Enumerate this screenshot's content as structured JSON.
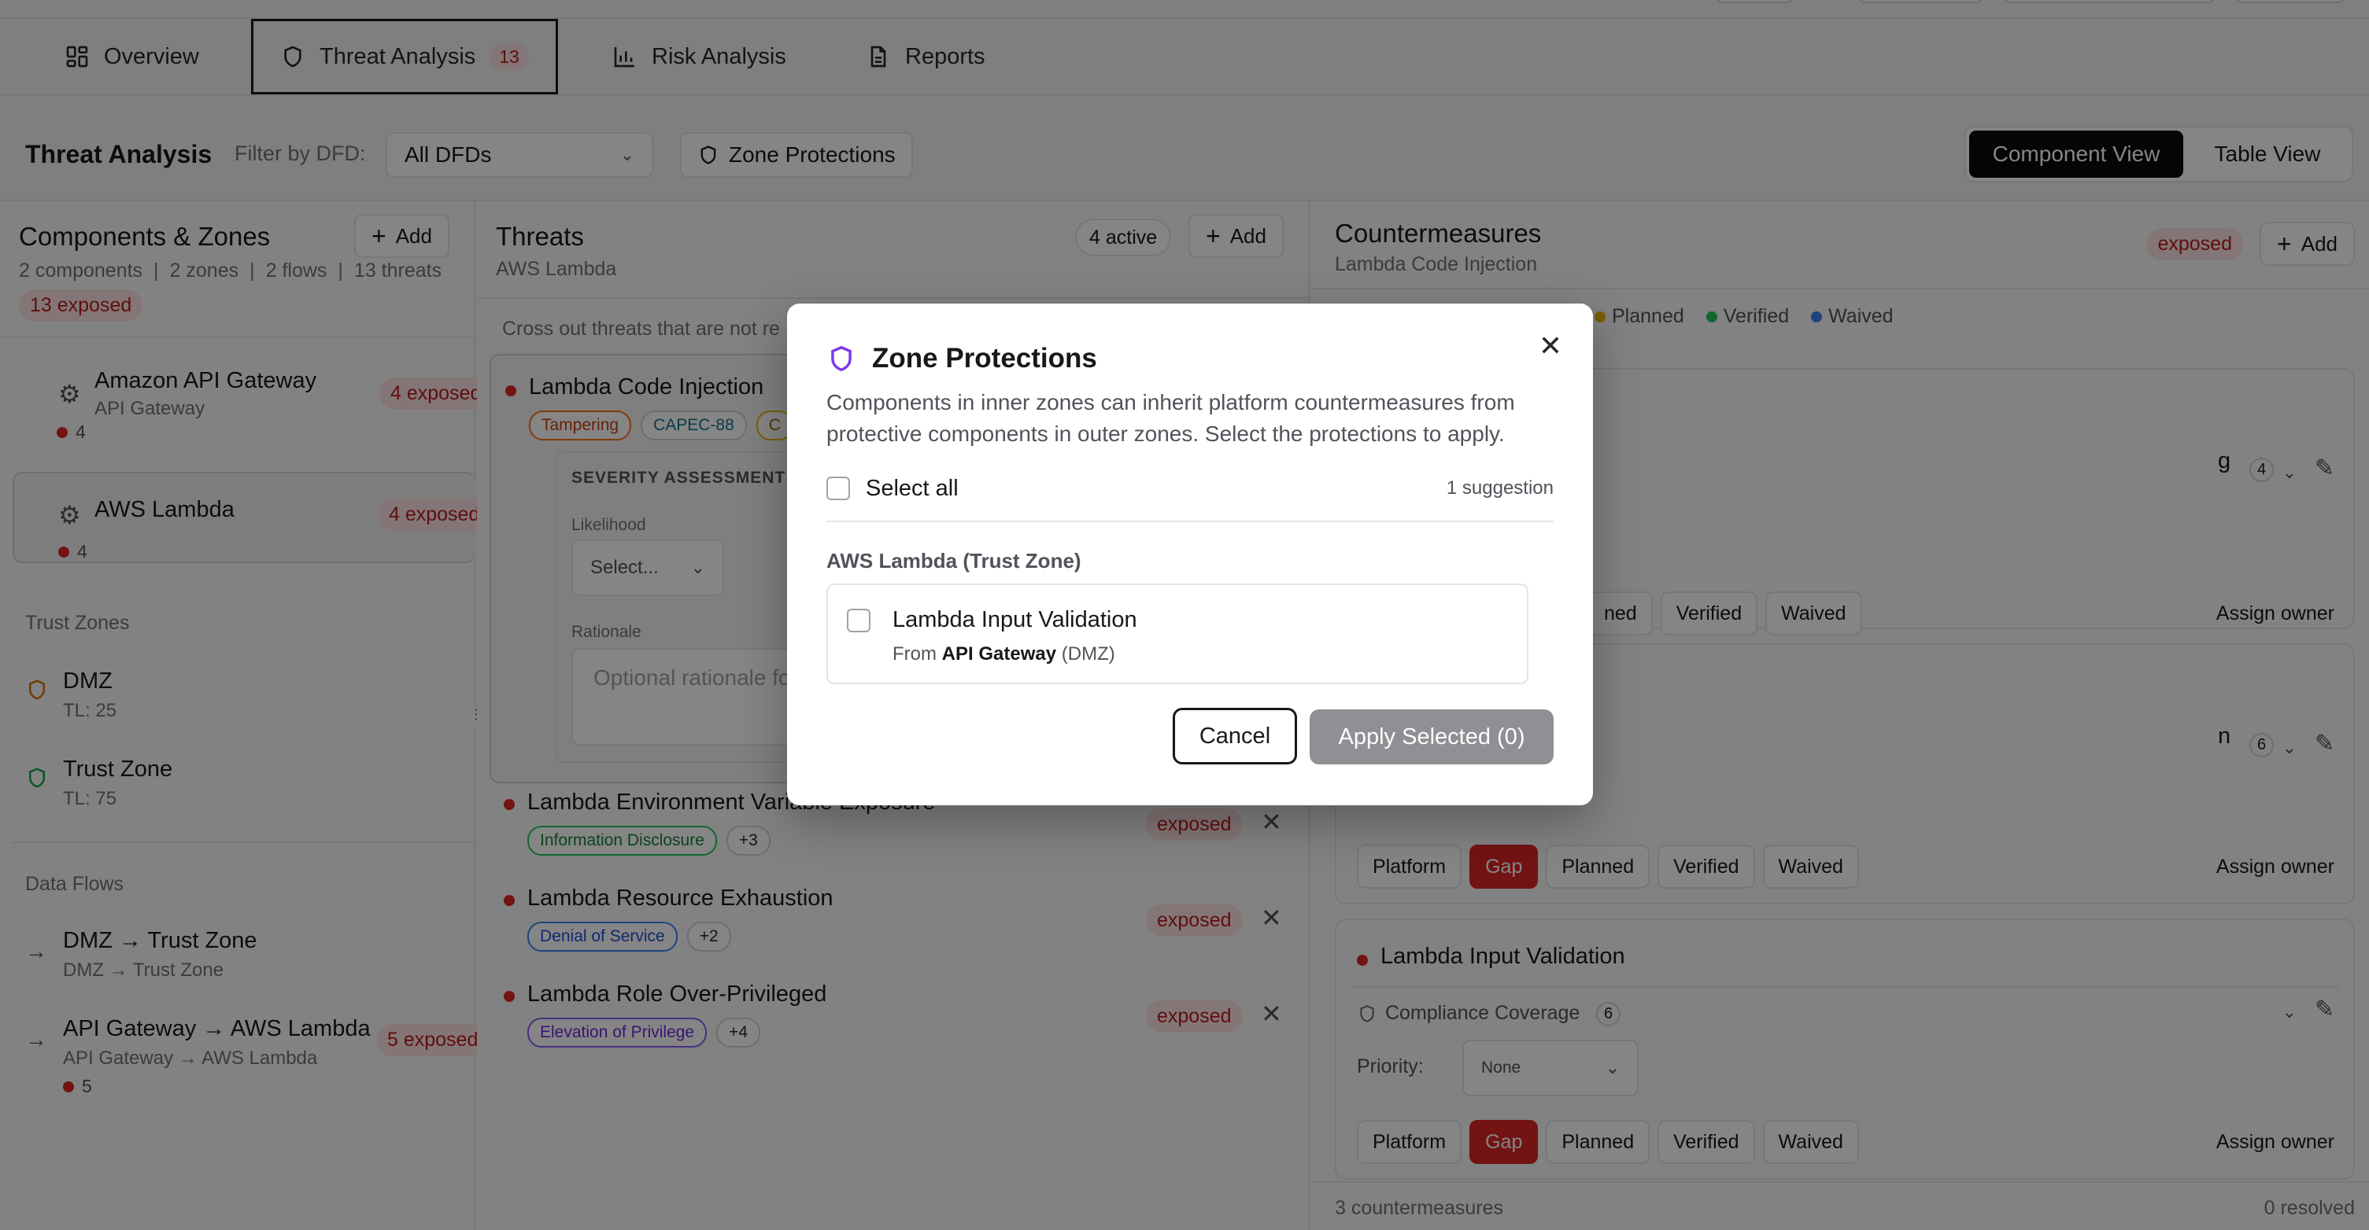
{
  "tabs": [
    {
      "label": "Overview"
    },
    {
      "label": "Threat Analysis",
      "count": "13"
    },
    {
      "label": "Risk Analysis"
    },
    {
      "label": "Reports"
    }
  ],
  "toolbar": {
    "title": "Threat Analysis",
    "filter_label": "Filter by DFD:",
    "filter_value": "All DFDs",
    "zone_protections": "Zone Protections",
    "view_component": "Component View",
    "view_table": "Table View"
  },
  "left": {
    "title": "Components & Zones",
    "add": "Add",
    "stats": {
      "components": "2 components",
      "zones": "2 zones",
      "flows": "2 flows",
      "threats": "13 threats",
      "sep": "|"
    },
    "exposed_badge": "13 exposed",
    "components": [
      {
        "name": "Amazon API Gateway",
        "type": "API Gateway",
        "count": "4",
        "badge": "4 exposed"
      },
      {
        "name": "AWS Lambda",
        "type": "",
        "count": "4",
        "badge": "4 exposed"
      }
    ],
    "zones_title": "Trust Zones",
    "zones": [
      {
        "name": "DMZ",
        "tl": "TL: 25"
      },
      {
        "name": "Trust Zone",
        "tl": "TL: 75"
      }
    ],
    "flows_title": "Data Flows",
    "flows": [
      {
        "name": "DMZ → Trust Zone",
        "sub": "DMZ → Trust Zone"
      },
      {
        "name": "API Gateway → AWS Lambda",
        "sub": "API Gateway → AWS Lambda",
        "count": "5",
        "badge": "5 exposed"
      }
    ]
  },
  "mid": {
    "title": "Threats",
    "subtitle": "AWS Lambda",
    "active": "4 active",
    "add": "Add",
    "hint": "Cross out threats that are not re",
    "first": {
      "name": "Lambda Code Injection",
      "tags": [
        "Tampering",
        "CAPEC-88",
        "C"
      ],
      "severity_title": "SEVERITY ASSESSMENT",
      "likelihood_label": "Likelihood",
      "likelihood_value": "Select...",
      "rationale_label": "Rationale",
      "rationale_placeholder": "Optional rationale fo"
    },
    "threats": [
      {
        "name": "Lambda Environment Variable Exposure",
        "tag": "Information Disclosure",
        "more": "+3",
        "status": "exposed"
      },
      {
        "name": "Lambda Resource Exhaustion",
        "tag": "Denial of Service",
        "more": "+2",
        "status": "exposed"
      },
      {
        "name": "Lambda Role Over-Privileged",
        "tag": "Elevation of Privilege",
        "more": "+4",
        "status": "exposed"
      }
    ]
  },
  "right": {
    "title": "Countermeasures",
    "subtitle": "Lambda Code Injection",
    "exposed": "exposed",
    "add": "Add",
    "legend": [
      "Planned",
      "Verified",
      "Waived"
    ],
    "cards": [
      {
        "name_tail": "g",
        "coverage_count": "4",
        "statuses": [
          "ned",
          "Verified",
          "Waived"
        ],
        "owner": "Assign owner"
      },
      {
        "name_tail": "n",
        "coverage_count": "6",
        "statuses": [
          "Platform",
          "Gap",
          "Planned",
          "Verified",
          "Waived"
        ],
        "owner": "Assign owner"
      },
      {
        "name": "Lambda Input Validation",
        "coverage": "Compliance Coverage",
        "coverage_count": "6",
        "priority_label": "Priority:",
        "priority_value": "None",
        "statuses": [
          "Platform",
          "Gap",
          "Planned",
          "Verified",
          "Waived"
        ],
        "owner": "Assign owner"
      }
    ],
    "footer_count": "3 countermeasures",
    "footer_resolved": "0 resolved"
  },
  "modal": {
    "title": "Zone Protections",
    "description": "Components in inner zones can inherit platform countermeasures from protective components in outer zones. Select the protections to apply.",
    "select_all": "Select all",
    "suggestion": "1 suggestion",
    "zone_label": "AWS Lambda (Trust Zone)",
    "item_name": "Lambda Input Validation",
    "item_from_prefix": "From",
    "item_from_component": "API Gateway",
    "item_from_zone": "(DMZ)",
    "cancel": "Cancel",
    "apply": "Apply Selected (0)"
  },
  "colors": {
    "accent": "#7c3aed",
    "danger": "#dc2626",
    "exposed_bg": "#fde2e2"
  }
}
